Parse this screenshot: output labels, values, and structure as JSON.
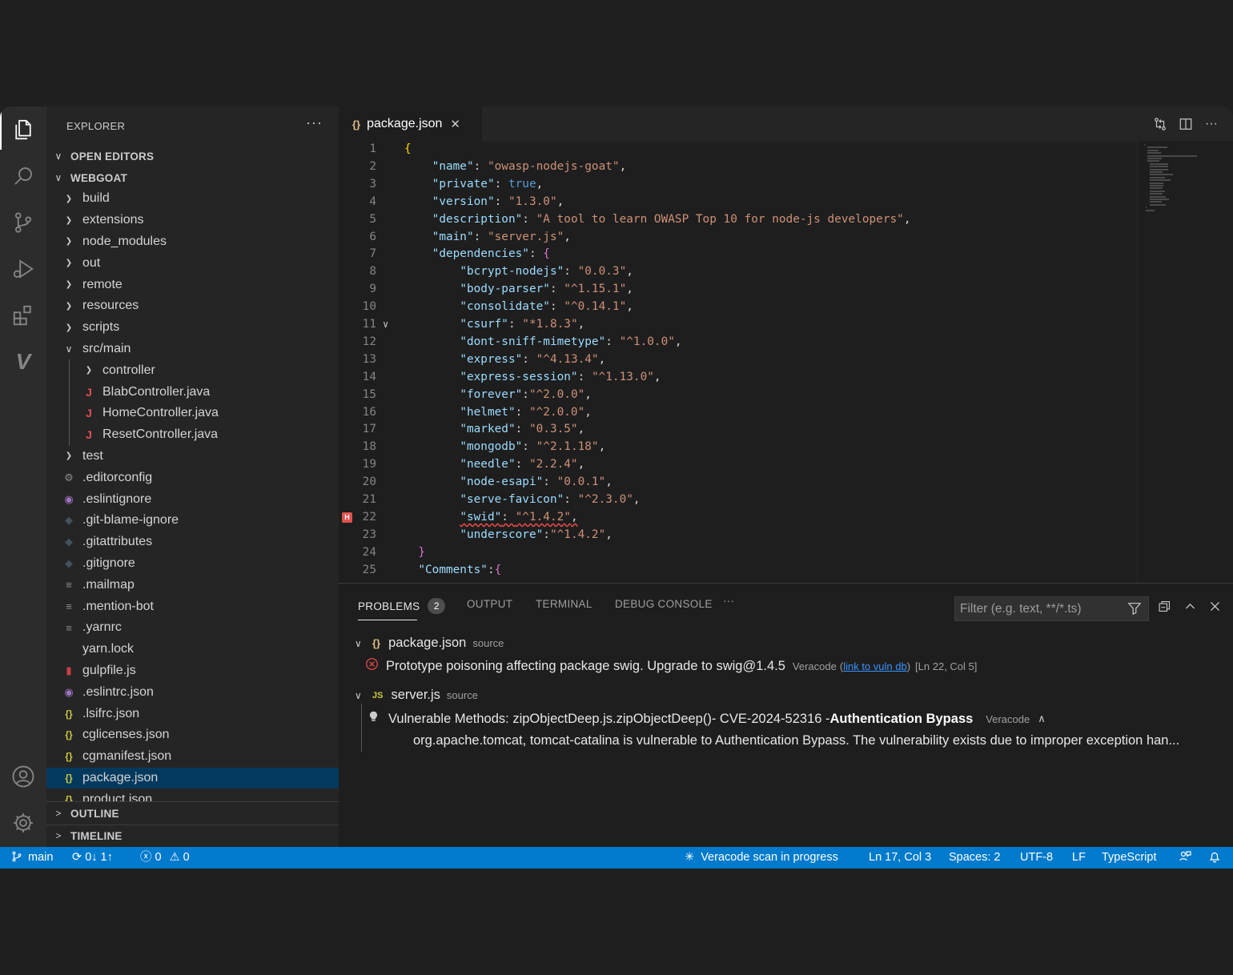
{
  "activity_bar": {
    "icons": [
      "explorer-icon",
      "search-icon",
      "source-control-icon",
      "run-debug-icon",
      "extensions-icon",
      "veracode-icon",
      "account-icon",
      "settings-gear-icon"
    ],
    "veracode_letter": "V"
  },
  "sidebar": {
    "title": "EXPLORER",
    "more": "···",
    "open_editors": "OPEN EDITORS",
    "project": "WEBGOAT",
    "outline": "OUTLINE",
    "timeline": "TIMELINE",
    "tree": [
      {
        "label": "build",
        "type": "folder",
        "indent": 0
      },
      {
        "label": "extensions",
        "type": "folder",
        "indent": 0
      },
      {
        "label": "node_modules",
        "type": "folder",
        "indent": 0
      },
      {
        "label": "out",
        "type": "folder",
        "indent": 0
      },
      {
        "label": "remote",
        "type": "folder",
        "indent": 0
      },
      {
        "label": "resources",
        "type": "folder",
        "indent": 0
      },
      {
        "label": "scripts",
        "type": "folder",
        "indent": 0
      },
      {
        "label": "src/main",
        "type": "folder-open",
        "indent": 0
      },
      {
        "label": "controller",
        "type": "folder",
        "indent": 1
      },
      {
        "label": "BlabController.java",
        "type": "java",
        "indent": 1
      },
      {
        "label": "HomeController.java",
        "type": "java",
        "indent": 1
      },
      {
        "label": "ResetController.java",
        "type": "java",
        "indent": 1
      },
      {
        "label": "test",
        "type": "folder",
        "indent": 0
      },
      {
        "label": ".editorconfig",
        "type": "gear",
        "indent": 0
      },
      {
        "label": ".eslintignore",
        "type": "eslint",
        "indent": 0
      },
      {
        "label": ".git-blame-ignore",
        "type": "git",
        "indent": 0
      },
      {
        "label": ".gitattributes",
        "type": "git",
        "indent": 0
      },
      {
        "label": ".gitignore",
        "type": "git",
        "indent": 0
      },
      {
        "label": ".mailmap",
        "type": "lines",
        "indent": 0
      },
      {
        "label": ".mention-bot",
        "type": "lines",
        "indent": 0
      },
      {
        "label": ".yarnrc",
        "type": "lines",
        "indent": 0
      },
      {
        "label": "yarn.lock",
        "type": "none",
        "indent": 0
      },
      {
        "label": "gulpfile.js",
        "type": "gulp",
        "indent": 0
      },
      {
        "label": ".eslintrc.json",
        "type": "eslint",
        "indent": 0
      },
      {
        "label": ".lsifrc.json",
        "type": "json",
        "indent": 0
      },
      {
        "label": "cglicenses.json",
        "type": "json",
        "indent": 0
      },
      {
        "label": "cgmanifest.json",
        "type": "json",
        "indent": 0
      },
      {
        "label": "package.json",
        "type": "json",
        "indent": 0,
        "selected": true
      },
      {
        "label": "product.json",
        "type": "json",
        "indent": 0
      }
    ]
  },
  "editor": {
    "tab": {
      "icon": "{}",
      "label": "package.json",
      "close": "✕"
    },
    "actions": [
      "compare-changes-icon",
      "split-editor-icon",
      "more-actions-icon"
    ],
    "lines": [
      {
        "n": "1",
        "tokens": [
          [
            "br",
            "{"
          ]
        ]
      },
      {
        "n": "2",
        "tokens": [
          [
            "p",
            "    "
          ],
          [
            "k",
            "\"name\""
          ],
          [
            "p",
            ": "
          ],
          [
            "s",
            "\"owasp-nodejs-goat\""
          ],
          [
            "p",
            ","
          ]
        ]
      },
      {
        "n": "3",
        "tokens": [
          [
            "p",
            "    "
          ],
          [
            "k",
            "\"private\""
          ],
          [
            "p",
            ": "
          ],
          [
            "b",
            "true"
          ],
          [
            "p",
            ","
          ]
        ]
      },
      {
        "n": "4",
        "tokens": [
          [
            "p",
            "    "
          ],
          [
            "k",
            "\"version\""
          ],
          [
            "p",
            ": "
          ],
          [
            "s",
            "\"1.3.0\""
          ],
          [
            "p",
            ","
          ]
        ]
      },
      {
        "n": "5",
        "tokens": [
          [
            "p",
            "    "
          ],
          [
            "k",
            "\"description\""
          ],
          [
            "p",
            ": "
          ],
          [
            "s",
            "\"A tool to learn OWASP Top 10 for node-js developers\""
          ],
          [
            "p",
            ","
          ]
        ]
      },
      {
        "n": "6",
        "tokens": [
          [
            "p",
            "    "
          ],
          [
            "k",
            "\"main\""
          ],
          [
            "p",
            ": "
          ],
          [
            "s",
            "\"server.js\""
          ],
          [
            "p",
            ","
          ]
        ]
      },
      {
        "n": "7",
        "tokens": [
          [
            "p",
            "    "
          ],
          [
            "k",
            "\"dependencies\""
          ],
          [
            "p",
            ": "
          ],
          [
            "br2",
            "{"
          ]
        ]
      },
      {
        "n": "8",
        "tokens": [
          [
            "p",
            "        "
          ],
          [
            "k",
            "\"bcrypt-nodejs\""
          ],
          [
            "p",
            ": "
          ],
          [
            "s",
            "\"0.0.3\""
          ],
          [
            "p",
            ","
          ]
        ]
      },
      {
        "n": "9",
        "tokens": [
          [
            "p",
            "        "
          ],
          [
            "k",
            "\"body-parser\""
          ],
          [
            "p",
            ": "
          ],
          [
            "s",
            "\"^1.15.1\""
          ],
          [
            "p",
            ","
          ]
        ]
      },
      {
        "n": "10",
        "tokens": [
          [
            "p",
            "        "
          ],
          [
            "k",
            "\"consolidate\""
          ],
          [
            "p",
            ": "
          ],
          [
            "s",
            "\"^0.14.1\""
          ],
          [
            "p",
            ","
          ]
        ]
      },
      {
        "n": "11",
        "fold": true,
        "tokens": [
          [
            "p",
            "        "
          ],
          [
            "k",
            "\"csurf\""
          ],
          [
            "p",
            ": "
          ],
          [
            "s",
            "\"*1.8.3\""
          ],
          [
            "p",
            ","
          ]
        ]
      },
      {
        "n": "12",
        "tokens": [
          [
            "p",
            "        "
          ],
          [
            "k",
            "\"dont-sniff-mimetype\""
          ],
          [
            "p",
            ": "
          ],
          [
            "s",
            "\"^1.0.0\""
          ],
          [
            "p",
            ","
          ]
        ]
      },
      {
        "n": "13",
        "tokens": [
          [
            "p",
            "        "
          ],
          [
            "k",
            "\"express\""
          ],
          [
            "p",
            ": "
          ],
          [
            "s",
            "\"^4.13.4\""
          ],
          [
            "p",
            ","
          ]
        ]
      },
      {
        "n": "14",
        "tokens": [
          [
            "p",
            "        "
          ],
          [
            "k",
            "\"express-session\""
          ],
          [
            "p",
            ": "
          ],
          [
            "s",
            "\"^1.13.0\""
          ],
          [
            "p",
            ","
          ]
        ]
      },
      {
        "n": "15",
        "tokens": [
          [
            "p",
            "        "
          ],
          [
            "k",
            "\"forever\""
          ],
          [
            "p",
            ":"
          ],
          [
            "s",
            "\"^2.0.0\""
          ],
          [
            "p",
            ","
          ]
        ]
      },
      {
        "n": "16",
        "tokens": [
          [
            "p",
            "        "
          ],
          [
            "k",
            "\"helmet\""
          ],
          [
            "p",
            ": "
          ],
          [
            "s",
            "\"^2.0.0\""
          ],
          [
            "p",
            ","
          ]
        ]
      },
      {
        "n": "17",
        "tokens": [
          [
            "p",
            "        "
          ],
          [
            "k",
            "\"marked\""
          ],
          [
            "p",
            ": "
          ],
          [
            "s",
            "\"0.3.5\""
          ],
          [
            "p",
            ","
          ]
        ]
      },
      {
        "n": "18",
        "tokens": [
          [
            "p",
            "        "
          ],
          [
            "k",
            "\"mongodb\""
          ],
          [
            "p",
            ": "
          ],
          [
            "s",
            "\"^2.1.18\""
          ],
          [
            "p",
            ","
          ]
        ]
      },
      {
        "n": "19",
        "tokens": [
          [
            "p",
            "        "
          ],
          [
            "k",
            "\"needle\""
          ],
          [
            "p",
            ": "
          ],
          [
            "s",
            "\"2.2.4\""
          ],
          [
            "p",
            ","
          ]
        ]
      },
      {
        "n": "20",
        "tokens": [
          [
            "p",
            "        "
          ],
          [
            "k",
            "\"node-esapi\""
          ],
          [
            "p",
            ": "
          ],
          [
            "s",
            "\"0.0.1\""
          ],
          [
            "p",
            ","
          ]
        ]
      },
      {
        "n": "21",
        "tokens": [
          [
            "p",
            "        "
          ],
          [
            "k",
            "\"serve-favicon\""
          ],
          [
            "p",
            ": "
          ],
          [
            "s",
            "\"^2.3.0\""
          ],
          [
            "p",
            ","
          ]
        ]
      },
      {
        "n": "22",
        "marker": "H",
        "squiggle": true,
        "tokens": [
          [
            "p",
            "        "
          ],
          [
            "k",
            "\"swid\""
          ],
          [
            "p",
            ": "
          ],
          [
            "s",
            "\"^1.4.2\""
          ],
          [
            "p",
            ","
          ]
        ]
      },
      {
        "n": "23",
        "tokens": [
          [
            "p",
            "        "
          ],
          [
            "k",
            "\"underscore\""
          ],
          [
            "p",
            ":"
          ],
          [
            "s",
            "\"^1.4.2\""
          ],
          [
            "p",
            ","
          ]
        ]
      },
      {
        "n": "24",
        "tokens": [
          [
            "p",
            "  "
          ],
          [
            "br2",
            "}"
          ]
        ]
      },
      {
        "n": "25",
        "tokens": [
          [
            "p",
            "  "
          ],
          [
            "k",
            "\"Comments\""
          ],
          [
            "p",
            ":"
          ],
          [
            "br2",
            "{"
          ]
        ]
      }
    ]
  },
  "panel": {
    "tabs": [
      {
        "label": "PROBLEMS",
        "badge": "2",
        "active": true
      },
      {
        "label": "OUTPUT"
      },
      {
        "label": "TERMINAL"
      },
      {
        "label": "DEBUG CONSOLE"
      }
    ],
    "more": "···",
    "filter_placeholder": "Filter (e.g. text, **/*.ts)",
    "groups": [
      {
        "file_icon": "{}",
        "file": "package.json",
        "source": "source",
        "message": "Prototype poisoning affecting package swig. Upgrade to swig@1.4.5",
        "provider": "Veracode",
        "link": "link to vuln db",
        "location": "[Ln 22, Col 5]"
      },
      {
        "file_icon": "JS",
        "file": "server.js",
        "source": "source",
        "message_prefix": "Vulnerable Methods: zipObjectDeep.js.zipObjectDeep()-   CVE-2024-52316 - ",
        "message_bold": "Authentication Bypass",
        "provider": "Veracode",
        "detail": "org.apache.tomcat, tomcat-catalina is vulnerable to Authentication Bypass. The vulnerability exists due to improper exception han..."
      }
    ]
  },
  "status_bar": {
    "branch": "main",
    "sync": "0↓ 1↑",
    "errors": "0",
    "warnings": "0",
    "scan": "Veracode scan in progress",
    "position": "Ln 17, Col 3",
    "spaces": "Spaces: 2",
    "encoding": "UTF-8",
    "eol": "LF",
    "language": "TypeScript"
  }
}
